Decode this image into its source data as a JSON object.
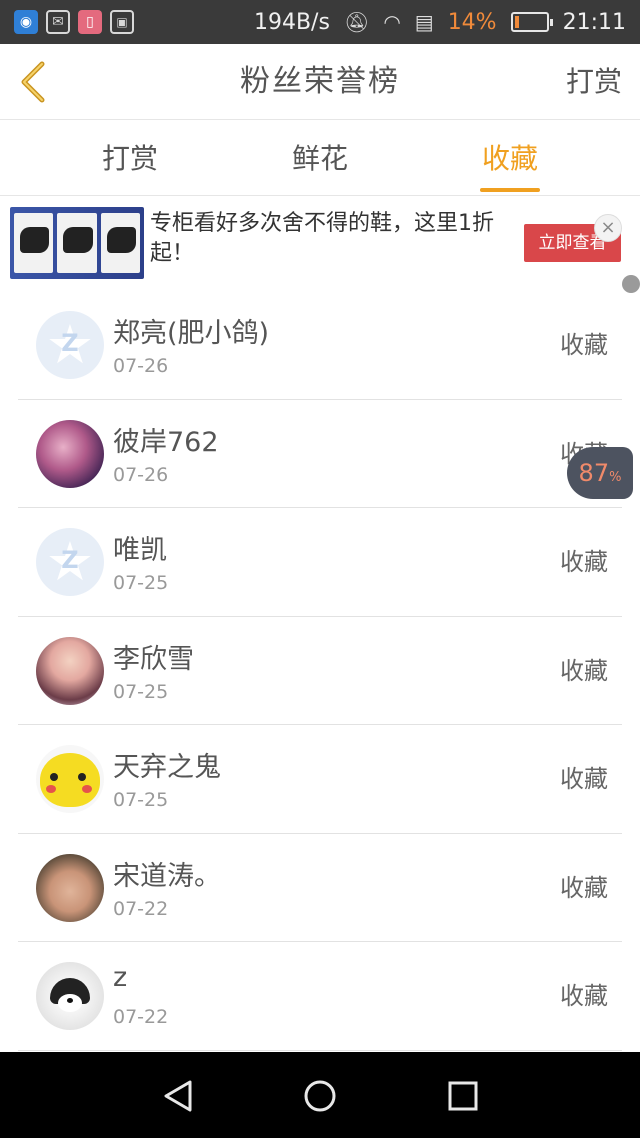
{
  "status_bar": {
    "net_speed": "194B/s",
    "battery_pct": "14%",
    "battery_fill": 0.14,
    "time": "21:11",
    "left_icons": [
      "wifi-hotspot-icon",
      "mail-icon",
      "notification-icon",
      "image-icon"
    ],
    "right_icons": [
      "mute-icon",
      "wifi-icon",
      "sim-icon"
    ]
  },
  "header": {
    "title": "粉丝荣誉榜",
    "right_action": "打赏",
    "back_icon": "chevron-left-icon"
  },
  "tabs": [
    {
      "label": "打赏",
      "active": false
    },
    {
      "label": "鲜花",
      "active": false
    },
    {
      "label": "收藏",
      "active": true
    }
  ],
  "ad": {
    "text": "专柜看好多次舍不得的鞋，这里1折起！",
    "button": "立即查看",
    "close_icon": "close-icon"
  },
  "floating_badge": {
    "value": "87",
    "unit": "%"
  },
  "list": [
    {
      "name": "郑亮(肥小鸽)",
      "date": "07-26",
      "action": "收藏",
      "avatar": "star"
    },
    {
      "name": "彼岸762",
      "date": "07-26",
      "action": "收藏",
      "avatar": "anime"
    },
    {
      "name": "唯凯",
      "date": "07-25",
      "action": "收藏",
      "avatar": "star"
    },
    {
      "name": "李欣雪",
      "date": "07-25",
      "action": "收藏",
      "avatar": "girl"
    },
    {
      "name": "天弃之鬼",
      "date": "07-25",
      "action": "收藏",
      "avatar": "pika"
    },
    {
      "name": "宋道涛。",
      "date": "07-22",
      "action": "收藏",
      "avatar": "man"
    },
    {
      "name": "z",
      "date": "07-22",
      "action": "收藏",
      "avatar": "dog"
    }
  ],
  "nav_bar": [
    "back-triangle-icon",
    "home-circle-icon",
    "recents-square-icon"
  ],
  "colors": {
    "accent": "#f0a020",
    "status_bar_bg": "#3a3a3a",
    "ad_button": "#d9474a",
    "nav_bar_bg": "#000000"
  }
}
